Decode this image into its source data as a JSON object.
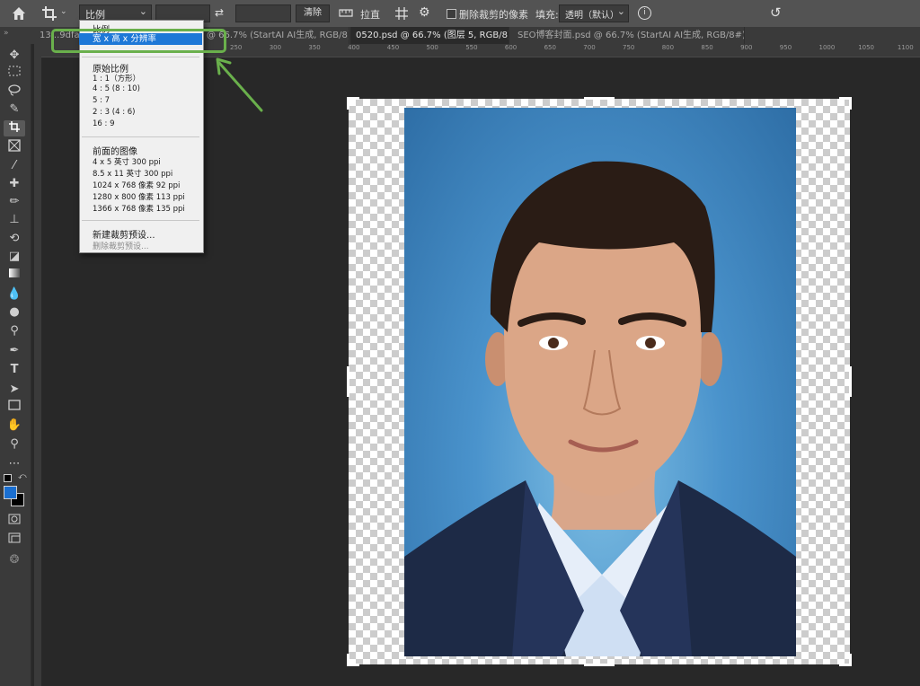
{
  "options_bar": {
    "ratio_select": "比例",
    "clear_button": "清除",
    "straighten_label": "拉直",
    "delete_cropped_label": "删除裁剪的像素",
    "fill_label": "填充:",
    "fill_select": "透明（默认）"
  },
  "tabs": [
    {
      "label": "13...9dfa-0",
      "close": "×"
    },
    {
      "label": "@ 66.7% (StartAI AI生成, RGB/8) *",
      "close": "×"
    },
    {
      "label": "0520.psd @ 66.7% (图层 5, RGB/8) *",
      "close": "×"
    },
    {
      "label": "SEO博客封面.psd @ 66.7% (StartAI AI生成, RGB/8#) *",
      "close": "×"
    }
  ],
  "ruler_ticks": [
    "250",
    "300",
    "350",
    "400",
    "450",
    "500",
    "550",
    "600",
    "650",
    "700",
    "750",
    "800",
    "850",
    "900",
    "950",
    "1000",
    "1050",
    "1100",
    "115"
  ],
  "dropdown": {
    "top_item": "比例",
    "highlighted": "宽 x 高 x 分辨率",
    "section1_title": "原始比例",
    "section1": [
      "1 : 1（方形）",
      "4 : 5 (8 : 10)",
      "5 : 7",
      "2 : 3 (4 : 6)",
      "16 : 9"
    ],
    "section2_title": "前面的图像",
    "section2": [
      "4 x 5 英寸 300 ppi",
      "8.5 x 11 英寸 300 ppi",
      "1024 x 768 像素 92 ppi",
      "1280 x 800 像素 113 ppi",
      "1366 x 768 像素 135 ppi"
    ],
    "new_preset": "新建裁剪预设...",
    "delete_preset": "删除裁剪预设..."
  },
  "colors": {
    "accent_highlight": "#1e78d7",
    "annotation_green": "#6ab04c",
    "foreground_color": "#1a6fd1",
    "background_color": "#000000"
  }
}
